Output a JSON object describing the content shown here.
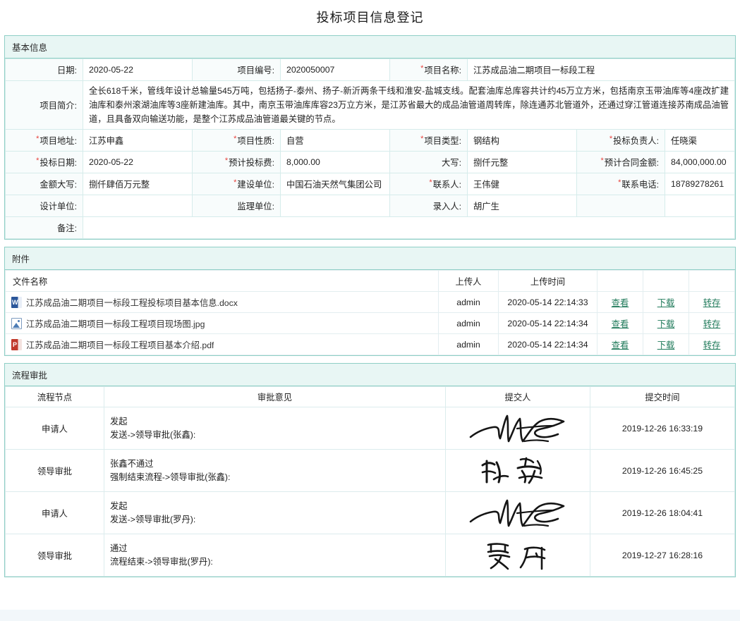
{
  "page": {
    "title": "投标项目信息登记"
  },
  "basic_info": {
    "section_title": "基本信息",
    "rows": {
      "date_label": "日期:",
      "date_value": "2020-05-22",
      "project_no_label": "项目编号:",
      "project_no_value": "2020050007",
      "project_name_label": "项目名称:",
      "project_name_value": "江苏成品油二期项目一标段工程",
      "summary_label": "项目简介:",
      "summary_value": "全长618千米，管线年设计总输量545万吨，包括扬子-泰州、扬子-新沂两条干线和淮安-盐城支线。配套油库总库容共计约45万立方米，包括南京玉带油库等4座改扩建油库和泰州滚湖油库等3座新建油库。其中，南京玉带油库库容23万立方米，是江苏省最大的成品油管道周转库，除连通苏北管道外，还通过穿江管道连接苏南成品油管道，且具备双向输送功能，是整个江苏成品油管道最关键的节点。",
      "address_label": "项目地址:",
      "address_value": "江苏申鑫",
      "nature_label": "项目性质:",
      "nature_value": "自营",
      "type_label": "项目类型:",
      "type_value": "钢结构",
      "owner_label": "投标负责人:",
      "owner_value": "任晓渠",
      "bid_date_label": "投标日期:",
      "bid_date_value": "2020-05-22",
      "bid_fee_label": "预计投标费:",
      "bid_fee_value": "8,000.00",
      "fee_caps_label": "大写:",
      "fee_caps_value": "捌仟元整",
      "contract_amount_label": "预计合同金额:",
      "contract_amount_value": "84,000,000.00",
      "amount_caps_label": "金额大写:",
      "amount_caps_value": "捌仟肆佰万元整",
      "builder_label": "建设单位:",
      "builder_value": "中国石油天然气集团公司",
      "contact_label": "联系人:",
      "contact_value": "王伟健",
      "phone_label": "联系电话:",
      "phone_value": "18789278261",
      "designer_label": "设计单位:",
      "designer_value": "",
      "supervisor_label": "监理单位:",
      "supervisor_value": "",
      "recorder_label": "录入人:",
      "recorder_value": "胡广生",
      "blank_label": "",
      "blank_value": "",
      "remark_label": "备注:",
      "remark_value": ""
    }
  },
  "attachments": {
    "section_title": "附件",
    "columns": {
      "name": "文件名称",
      "uploader": "上传人",
      "upload_time": "上传时间",
      "a1": "",
      "a2": "",
      "a3": ""
    },
    "actions": {
      "view": "查看",
      "download": "下载",
      "save": "转存"
    },
    "files": [
      {
        "icon": "word-file-icon",
        "name": "江苏成品油二期项目一标段工程投标项目基本信息.docx",
        "uploader": "admin",
        "time": "2020-05-14 22:14:33"
      },
      {
        "icon": "image-file-icon",
        "name": "江苏成品油二期项目一标段工程项目现场图.jpg",
        "uploader": "admin",
        "time": "2020-05-14 22:14:34"
      },
      {
        "icon": "pdf-file-icon",
        "name": "江苏成品油二期项目一标段工程项目基本介绍.pdf",
        "uploader": "admin",
        "time": "2020-05-14 22:14:34"
      }
    ]
  },
  "workflow": {
    "section_title": "流程审批",
    "columns": {
      "node": "流程节点",
      "opinion": "审批意见",
      "submitter": "提交人",
      "time": "提交时间"
    },
    "rows": [
      {
        "node": "申请人",
        "opinion_line1": "发起",
        "opinion_line2": "发送->领导审批(张鑫):",
        "signature_name": "胡广生",
        "signature_style": "cursive-scrawl",
        "time": "2019-12-26 16:33:19"
      },
      {
        "node": "领导审批",
        "opinion_line1": "张鑫不通过",
        "opinion_line2": "强制结束流程->领导审批(张鑫):",
        "signature_name": "张鑫",
        "signature_style": "brush",
        "time": "2019-12-26 16:45:25"
      },
      {
        "node": "申请人",
        "opinion_line1": "发起",
        "opinion_line2": "发送->领导审批(罗丹):",
        "signature_name": "胡广生",
        "signature_style": "cursive-scrawl",
        "time": "2019-12-26 18:04:41"
      },
      {
        "node": "领导审批",
        "opinion_line1": "通过",
        "opinion_line2": "流程结束->领导审批(罗丹):",
        "signature_name": "罗丹",
        "signature_style": "handwriting",
        "time": "2019-12-27 16:28:16"
      }
    ]
  },
  "colors": {
    "panel_border": "#8fcfc6",
    "section_header_bg": "#e8f6f4",
    "required_star": "#e8403a",
    "link_green": "#1f7a5a",
    "label_bg": "#f8fcfc",
    "bottom_strip": "#f2f7fa"
  }
}
